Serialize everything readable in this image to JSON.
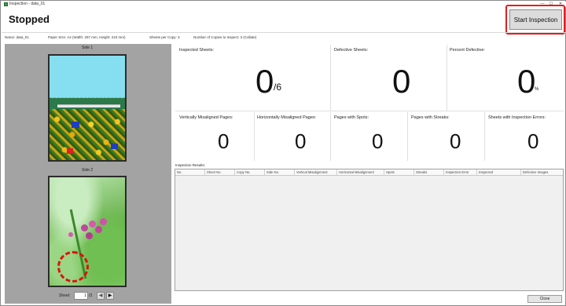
{
  "window": {
    "title": "Inspection - data_01",
    "minimize": "—",
    "maximize": "☐",
    "close": "✕"
  },
  "status": "Stopped",
  "start_button": "Start Inspection",
  "info": {
    "name": "Name:  data_01",
    "paper_size": "Paper Size:  A4  (Width: 297 mm, Height: 210 mm)",
    "sheets_per_copy": "Sheets per Copy:  3",
    "copies": "Number of Copies to Inspect:  3   (Collate)"
  },
  "preview": {
    "side1": "Side 1",
    "side2": "Side 2",
    "sheet_label": "Sheet:",
    "sheet_value": "1",
    "sheet_total": "/3",
    "prev": "◀",
    "next": "▶"
  },
  "metrics": {
    "inspected": {
      "label": "Inspected Sheets:",
      "value": "0",
      "suffix": "/6"
    },
    "defective": {
      "label": "Defective Sheets:",
      "value": "0"
    },
    "percent": {
      "label": "Percent Defective:",
      "value": "0",
      "suffix": "%"
    },
    "vertical": {
      "label": "Vertically Misaligned Pages:",
      "value": "0"
    },
    "horizontal": {
      "label": "Horizontally Misaligned Pages:",
      "value": "0"
    },
    "spots": {
      "label": "Pages with Spots:",
      "value": "0"
    },
    "streaks": {
      "label": "Pages with Streaks:",
      "value": "0"
    },
    "errors": {
      "label": "Sheets with Inspection Errors:",
      "value": "0"
    }
  },
  "results": {
    "label": "Inspection Results:",
    "columns": [
      "No.",
      "Sheet No.",
      "Copy No.",
      "Side No.",
      "Vertical Misalignment",
      "Horizontal Misalignment",
      "Spots",
      "Streaks",
      "Inspection Error",
      "Inspected",
      "Defective Images"
    ]
  },
  "close_button": "Close",
  "colors": {
    "highlight": "#e01e1e",
    "panel_bg": "#a3a3a3"
  }
}
